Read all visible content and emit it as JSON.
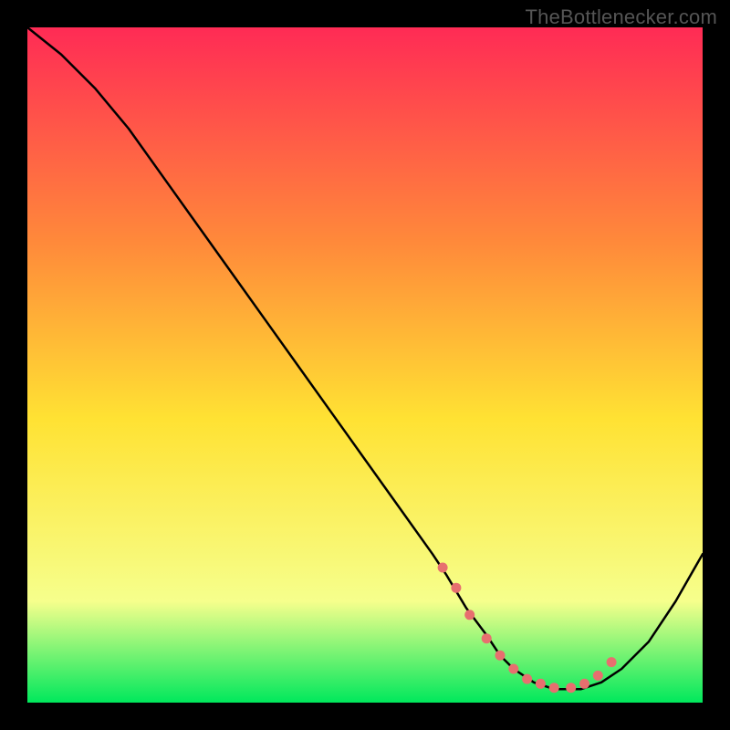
{
  "attribution": "TheBottlenecker.com",
  "colors": {
    "frame": "#000000",
    "curve": "#000000",
    "markers": "#e76f6f",
    "gradient_top": "#ff2b55",
    "gradient_mid_upper": "#ff8a3a",
    "gradient_mid": "#ffe233",
    "gradient_mid_lower": "#f6ff8c",
    "gradient_bottom": "#00e85c"
  },
  "chart_data": {
    "type": "line",
    "title": "",
    "xlabel": "",
    "ylabel": "",
    "xlim": [
      0,
      100
    ],
    "ylim": [
      0,
      100
    ],
    "grid": false,
    "legend": false,
    "x": [
      0,
      5,
      10,
      15,
      20,
      25,
      30,
      35,
      40,
      45,
      50,
      55,
      60,
      62,
      65,
      68,
      70,
      72,
      75,
      78,
      80,
      82,
      85,
      88,
      92,
      96,
      100
    ],
    "values": [
      100,
      96,
      91,
      85,
      78,
      71,
      64,
      57,
      50,
      43,
      36,
      29,
      22,
      19,
      14,
      10,
      7,
      5,
      3,
      2,
      2,
      2,
      3,
      5,
      9,
      15,
      22
    ],
    "markers": {
      "x": [
        61.5,
        63.5,
        65.5,
        68,
        70,
        72,
        74,
        76,
        78,
        80.5,
        82.5,
        84.5,
        86.5
      ],
      "y": [
        20,
        17,
        13,
        9.5,
        7,
        5,
        3.5,
        2.8,
        2.2,
        2.2,
        2.8,
        4,
        6
      ]
    }
  }
}
